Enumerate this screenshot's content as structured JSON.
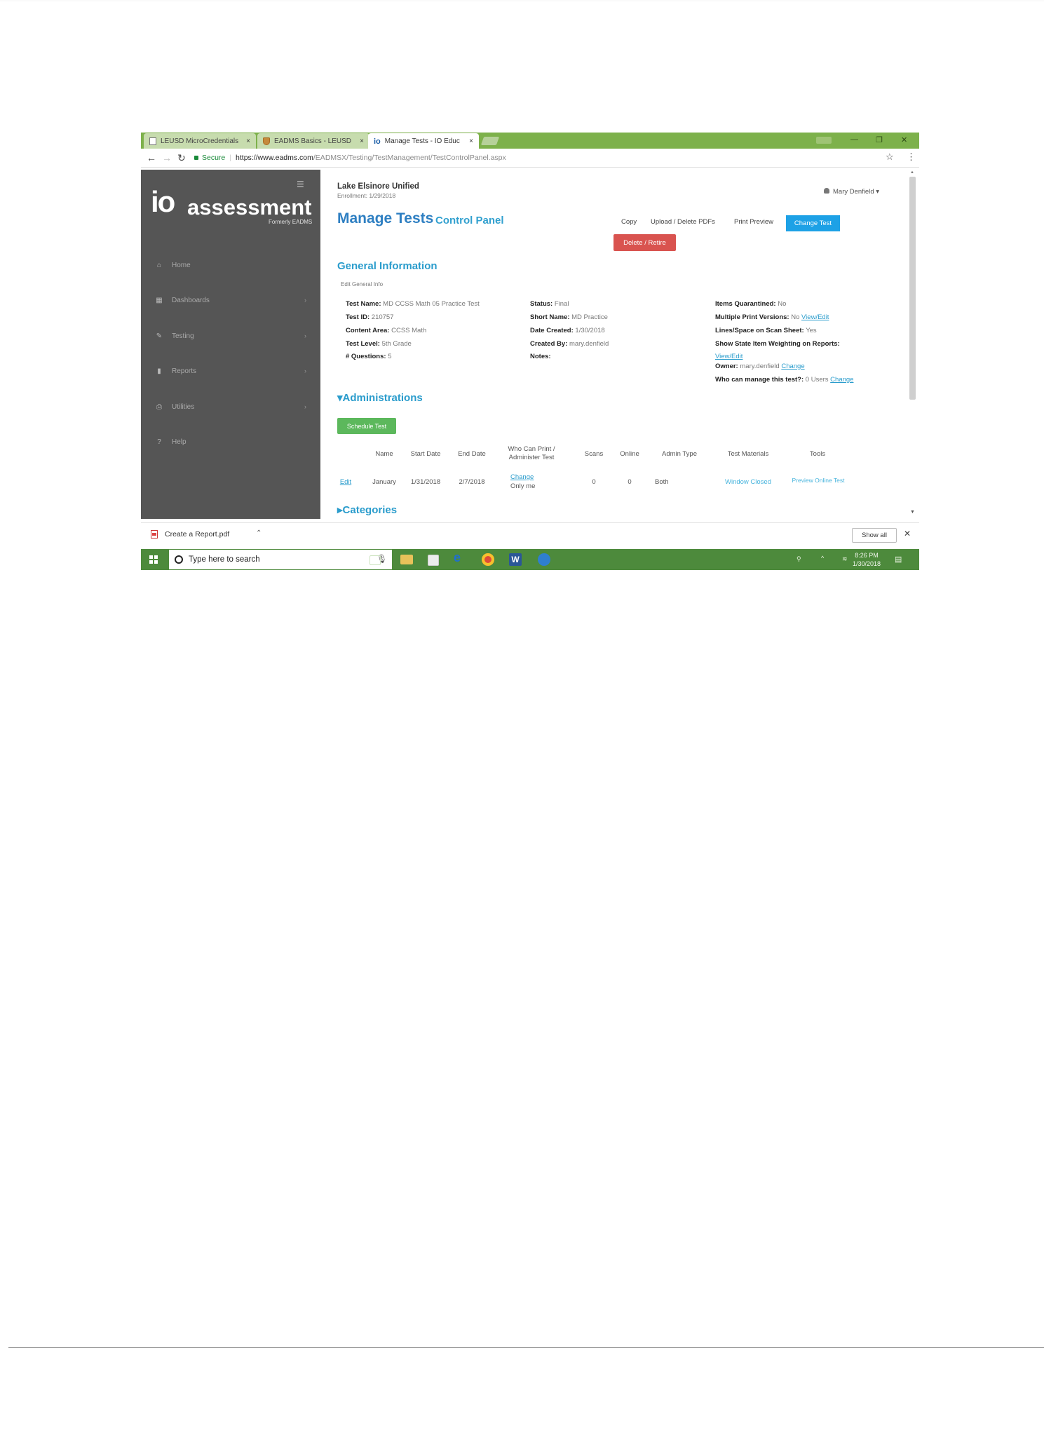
{
  "browser": {
    "tabs": [
      {
        "label": "LEUSD MicroCredentials",
        "close": "×"
      },
      {
        "label": "EADMS Basics - LEUSD",
        "close": "×"
      },
      {
        "label": "Manage Tests - IO Educ",
        "close": "×"
      }
    ],
    "secure_label": "Secure",
    "url_host": "https://www.eadms.com",
    "url_path": "/EADMSX/Testing/TestManagement/TestControlPanel.aspx"
  },
  "sidebar": {
    "logo_mark": "io",
    "logo_word": "assessment",
    "logo_sub": "Formerly EADMS",
    "items": [
      {
        "label": "Home",
        "icon": "home-icon"
      },
      {
        "label": "Dashboards",
        "icon": "dashboard-icon"
      },
      {
        "label": "Testing",
        "icon": "pencil-icon"
      },
      {
        "label": "Reports",
        "icon": "bar-chart-icon"
      },
      {
        "label": "Utilities",
        "icon": "printer-icon"
      },
      {
        "label": "Help",
        "icon": "help-icon"
      }
    ]
  },
  "header": {
    "org": "Lake Elsinore Unified",
    "enrollment": "Enrollment: 1/29/2018",
    "user": "Mary Denfield"
  },
  "page": {
    "title": "Manage Tests",
    "subtitle": "Control Panel",
    "actions": {
      "copy": "Copy",
      "upload": "Upload / Delete PDFs",
      "print_preview": "Print Preview",
      "change_test": "Change Test",
      "delete_retire": "Delete / Retire"
    }
  },
  "general": {
    "heading": "General Information",
    "edit_link": "Edit General Info",
    "col1": [
      {
        "label": "Test Name:",
        "value": "MD CCSS Math 05 Practice Test"
      },
      {
        "label": "Test ID:",
        "value": "210757"
      },
      {
        "label": "Content Area:",
        "value": "CCSS Math"
      },
      {
        "label": "Test Level:",
        "value": "5th Grade"
      },
      {
        "label": "# Questions:",
        "value": "5"
      }
    ],
    "col2": [
      {
        "label": "Status:",
        "value": "Final"
      },
      {
        "label": "Short Name:",
        "value": "MD Practice"
      },
      {
        "label": "Date Created:",
        "value": "1/30/2018"
      },
      {
        "label": "Created By:",
        "value": "mary.denfield"
      },
      {
        "label": "Notes:",
        "value": ""
      }
    ],
    "col3": {
      "items_quarantined_label": "Items Quarantined:",
      "items_quarantined": "No",
      "multi_print_label": "Multiple Print Versions:",
      "multi_print": "No",
      "multi_print_link": "View/Edit",
      "lines_space_label": "Lines/Space on Scan Sheet:",
      "lines_space": "Yes",
      "weighting_label": "Show State Item Weighting on Reports:",
      "weighting_link": "View/Edit",
      "owner_label": "Owner:",
      "owner": "mary.denfield",
      "owner_link": "Change",
      "who_manage_label": "Who can manage this test?:",
      "who_manage": "0 Users",
      "who_manage_link": "Change"
    }
  },
  "administrations": {
    "heading": "Administrations",
    "schedule_button": "Schedule Test",
    "columns": [
      "Name",
      "Start Date",
      "End Date",
      "Who Can Print / Administer Test",
      "Scans",
      "Online",
      "Admin Type",
      "Test Materials",
      "Tools"
    ],
    "rows": [
      {
        "edit": "Edit",
        "name": "January",
        "start": "1/31/2018",
        "end": "2/7/2018",
        "who_link": "Change",
        "who": "Only me",
        "scans": "0",
        "online": "0",
        "admin_type": "Both",
        "materials": "Window Closed",
        "tools": "Preview Online Test"
      }
    ]
  },
  "categories": {
    "heading": "Categories"
  },
  "download_bar": {
    "file": "Create a Report.pdf",
    "show_all": "Show all"
  },
  "taskbar": {
    "search_placeholder": "Type here to search",
    "time": "8:26 PM",
    "date": "1/30/2018"
  },
  "colors": {
    "brand_blue": "#2e7fc2",
    "accent_cyan": "#31a0cf",
    "sidebar_gray": "#555555",
    "tab_green": "#7db14b",
    "danger": "#d9534f",
    "success": "#5cb85c",
    "button_blue": "#1da1e6"
  }
}
